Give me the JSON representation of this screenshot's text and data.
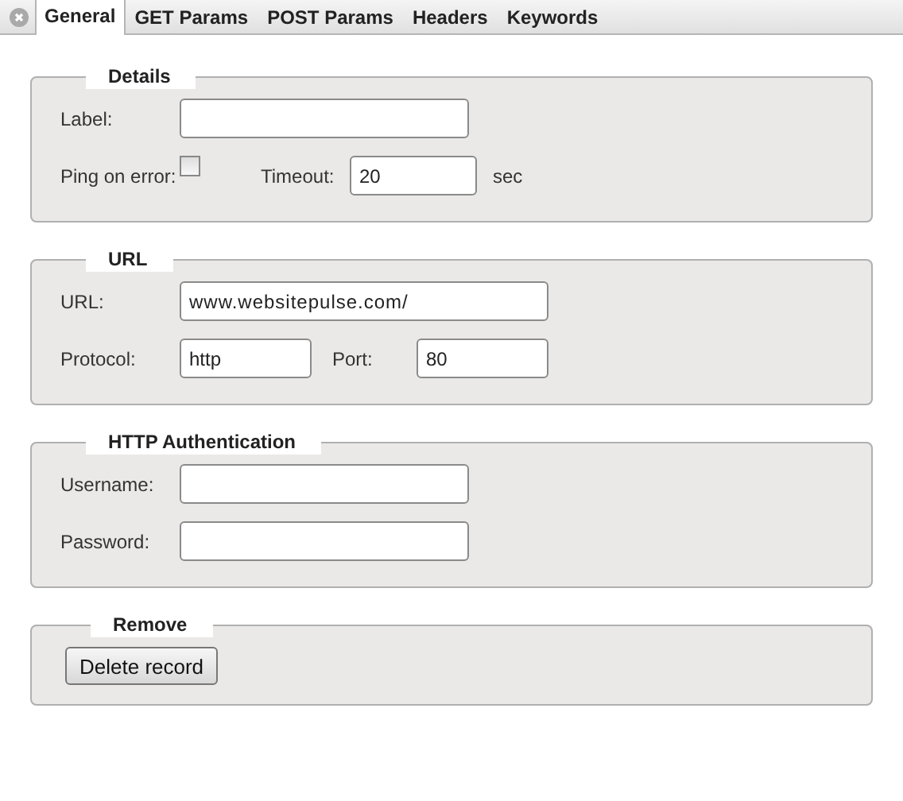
{
  "tabs": [
    {
      "label": "General",
      "selected": true
    },
    {
      "label": "GET Params",
      "selected": false
    },
    {
      "label": "POST Params",
      "selected": false
    },
    {
      "label": "Headers",
      "selected": false
    },
    {
      "label": "Keywords",
      "selected": false
    }
  ],
  "sections": [
    {
      "title": "Details",
      "rows": [
        [
          {
            "kind": "label",
            "text": "Label:"
          },
          {
            "kind": "input"
          }
        ],
        [
          {
            "kind": "label",
            "text": "Ping on error:"
          },
          {
            "kind": "checkbox",
            "checked": false
          },
          {
            "kind": "label",
            "text": "Timeout:"
          },
          {
            "kind": "input",
            "value": "20"
          },
          {
            "kind": "unit",
            "text": "sec"
          }
        ]
      ]
    },
    {
      "title": "URL",
      "rows": [
        [
          {
            "kind": "label",
            "text": "URL:"
          },
          {
            "kind": "input",
            "value": "www.websitepulse.com/"
          }
        ],
        [
          {
            "kind": "label",
            "text": "Protocol:"
          },
          {
            "kind": "input",
            "value": "http"
          },
          {
            "kind": "label",
            "text": "Port:"
          },
          {
            "kind": "input",
            "value": "80"
          }
        ]
      ]
    },
    {
      "title": "HTTP Authentication",
      "rows": [
        [
          {
            "kind": "label",
            "text": "Username:"
          },
          {
            "kind": "input"
          }
        ],
        [
          {
            "kind": "label",
            "text": "Password:"
          },
          {
            "kind": "input"
          }
        ]
      ]
    },
    {
      "title": "Remove",
      "rows": [
        [
          {
            "kind": "button",
            "text": "Delete record"
          }
        ]
      ]
    }
  ]
}
